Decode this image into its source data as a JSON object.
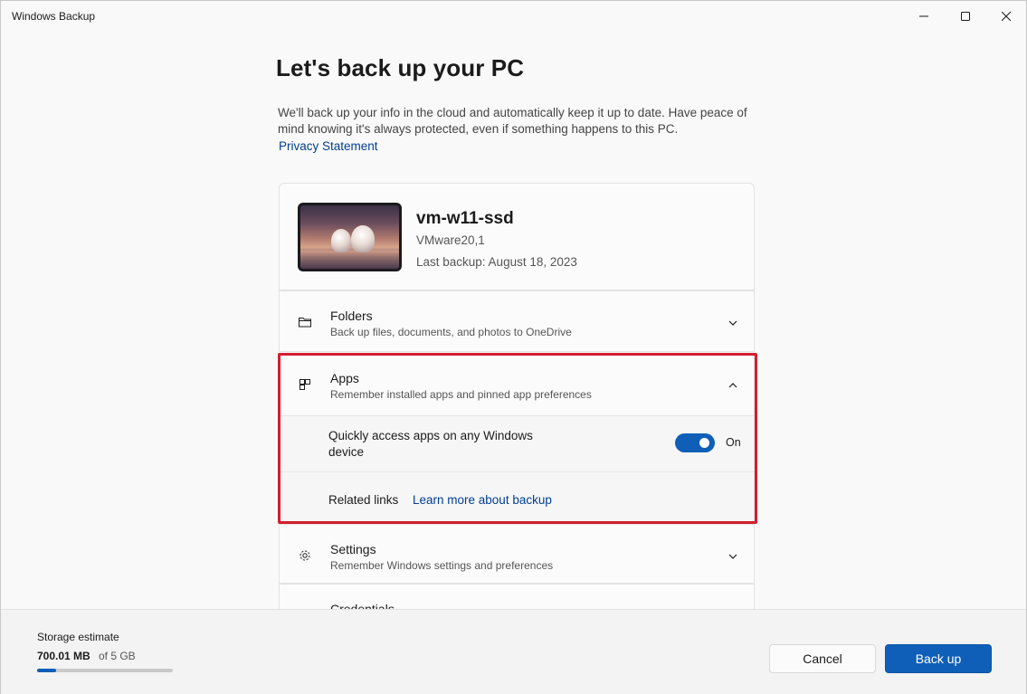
{
  "window": {
    "title": "Windows Backup"
  },
  "page": {
    "title": "Let's back up your PC",
    "description": "We'll back up your info in the cloud and automatically keep it up to date. Have peace of mind knowing it's always protected, even if something happens to this PC.",
    "privacy_link": "Privacy Statement"
  },
  "device": {
    "name": "vm-w11-ssd",
    "model": "VMware20,1",
    "last_backup": "Last backup: August 18, 2023"
  },
  "sections": {
    "folders": {
      "title": "Folders",
      "subtitle": "Back up files, documents, and photos to OneDrive",
      "icon": "folder-icon"
    },
    "apps": {
      "title": "Apps",
      "subtitle": "Remember installed apps and pinned app preferences",
      "icon": "apps-icon",
      "toggle_text": "Quickly access apps on any Windows device",
      "toggle_state": "On",
      "related_label": "Related links",
      "related_link": "Learn more about backup"
    },
    "settings": {
      "title": "Settings",
      "subtitle": "Remember Windows settings and preferences",
      "icon": "gear-icon"
    },
    "credentials": {
      "title": "Credentials"
    }
  },
  "footer": {
    "storage_label": "Storage estimate",
    "storage_used": "700.01 MB",
    "storage_total": "of 5 GB",
    "storage_fraction": 0.137,
    "cancel_label": "Cancel",
    "backup_label": "Back up"
  },
  "colors": {
    "accent": "#0f5fb8",
    "link": "#003e92",
    "highlight": "#d21f2f"
  }
}
